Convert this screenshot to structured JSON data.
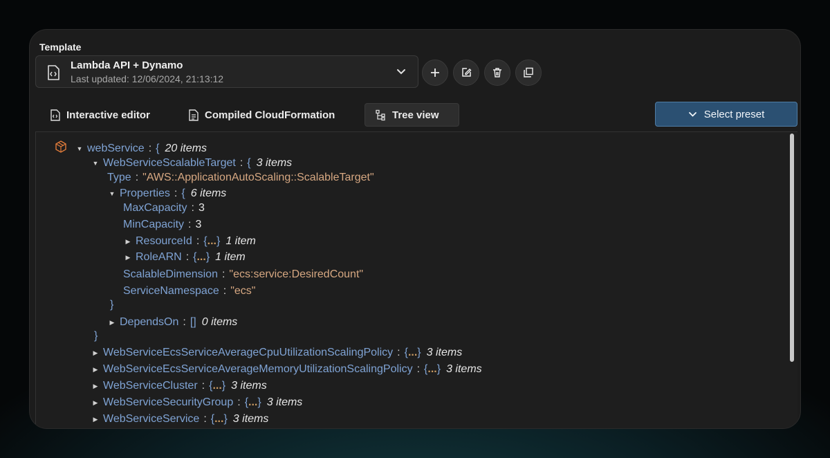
{
  "template": {
    "label": "Template",
    "name": "Lambda API + Dynamo",
    "updated": "Last updated: 12/06/2024, 21:13:12"
  },
  "actions": {
    "add_icon": "plus-icon",
    "edit_icon": "edit-icon",
    "delete_icon": "trash-icon",
    "duplicate_icon": "copy-icon"
  },
  "tabs": [
    {
      "label": "Interactive editor",
      "icon": "code-file-icon"
    },
    {
      "label": "Compiled CloudFormation",
      "icon": "document-icon"
    },
    {
      "label": "Tree view",
      "icon": "tree-icon",
      "active": true
    }
  ],
  "preset": {
    "label": "Select preset"
  },
  "tree": {
    "root_key": "webService",
    "root_count": "20 items",
    "scalable_target_key": "WebServiceScalableTarget",
    "scalable_target_count": "3 items",
    "type_key": "Type",
    "type_value": "\"AWS::ApplicationAutoScaling::ScalableTarget\"",
    "properties_key": "Properties",
    "properties_count": "6 items",
    "max_key": "MaxCapacity",
    "max_value": "3",
    "min_key": "MinCapacity",
    "min_value": "3",
    "resource_key": "ResourceId",
    "resource_count": "1 item",
    "role_key": "RoleARN",
    "role_count": "1 item",
    "dimension_key": "ScalableDimension",
    "dimension_value": "\"ecs:service:DesiredCount\"",
    "namespace_key": "ServiceNamespace",
    "namespace_value": "\"ecs\"",
    "depends_key": "DependsOn",
    "depends_count": "0 items",
    "collapsed": [
      {
        "key": "WebServiceEcsServiceAverageCpuUtilizationScalingPolicy",
        "count": "3 items"
      },
      {
        "key": "WebServiceEcsServiceAverageMemoryUtilizationScalingPolicy",
        "count": "3 items"
      },
      {
        "key": "WebServiceCluster",
        "count": "3 items"
      },
      {
        "key": "WebServiceSecurityGroup",
        "count": "3 items"
      },
      {
        "key": "WebServiceService",
        "count": "3 items"
      }
    ]
  },
  "colors": {
    "key": "#7fa3d4",
    "string": "#d7a882",
    "preset": "#2b5072",
    "lambda": "#e07b3a"
  }
}
